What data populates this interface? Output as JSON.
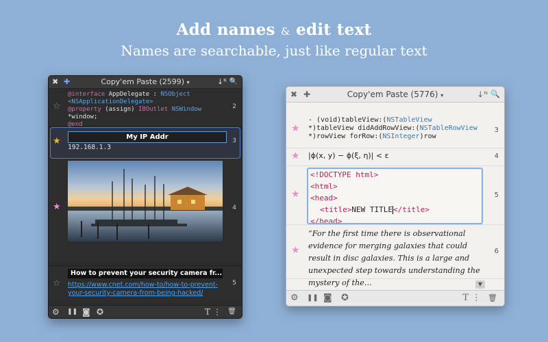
{
  "headline": {
    "title_part1": "Add names",
    "title_amp": "&",
    "title_part2": "edit text",
    "subtitle": "Names are searchable, just like regular text"
  },
  "dark_window": {
    "title": "Copy'em Paste (2599)",
    "title_arrow": "▾",
    "sort_icon": "↓ᴿ",
    "search_icon": "🔍",
    "items": {
      "code": {
        "line1_kw": "@interface",
        "line1_tx": " AppDelegate : ",
        "line1_ty": "NSObject",
        "line2_tx": "<",
        "line2_ty": "NSApplicationDelegate",
        "line2_tx2": ">",
        "line3_kw": "@property",
        "line3_tx": " (assign) ",
        "line3_kw2": "IBOutlet",
        "line3_tx2": " ",
        "line3_ty": "NSWindow",
        "line3_tx3": " *window;",
        "line4_kw": "@end",
        "number": "2"
      },
      "ip": {
        "name": "My IP Addr",
        "value": "192.168.1.3",
        "number": "3"
      },
      "photo": {
        "number": "4"
      },
      "link": {
        "name": "How to prevent your security camera fr...",
        "url": "https://www.cnet.com/how-to/how-to-prevent-your-security-camera-from-being-hacked/",
        "number": "5"
      }
    },
    "footer": {
      "gear": "⚙",
      "pause": "❚❚",
      "camera": "◙",
      "star_badge": "✪",
      "text_tool": "T",
      "more": "⋮",
      "trash": "🗑"
    }
  },
  "light_window": {
    "title": "Copy'em Paste (5776)",
    "title_arrow": "▾",
    "sort_icon": "↓ᴺ",
    "search_icon": "🔍",
    "items": {
      "objc": {
        "line1_tx": "- (void)tableView:(",
        "line1_ty": "NSTableView",
        "line2_tx": "*)tableView didAddRowView:(",
        "line2_ty": "NSTableRowView",
        "line3_tx": "*)rowView forRow:(",
        "line3_ty": "NSInteger",
        "line3_tx2": ")row",
        "number": "3"
      },
      "math": {
        "text": "|ϕ(x, y) − ϕ(ξ, η)| < ε",
        "number": "4"
      },
      "html": {
        "l1": "<!DOCTYPE html>",
        "l2": "<html>",
        "l3": "<head>",
        "l4_open": "<title>",
        "l4_text": "NEW TITLE",
        "l4_close": "</title>",
        "l5": "</head>",
        "number": "5"
      },
      "quote": {
        "text": "“For the first time there is observational evidence for merging galaxies that could result in disc galaxies. This is a large and unexpected step towards understanding the mystery of the…",
        "number": "6"
      }
    },
    "footer": {
      "gear": "⚙",
      "pause": "❚❚",
      "camera": "◙",
      "star_badge": "✪",
      "text_tool": "T",
      "more": "⋮",
      "trash": "🗑"
    }
  }
}
